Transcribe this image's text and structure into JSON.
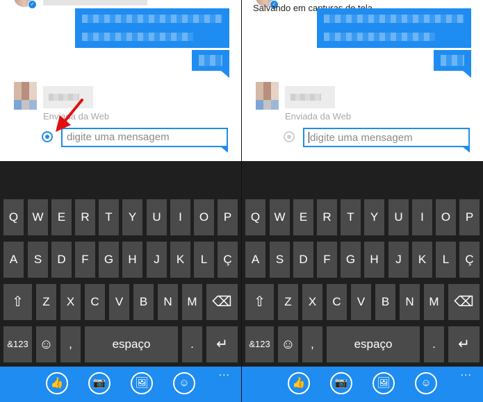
{
  "panels": [
    {
      "status_toast": "",
      "sent_label": "Enviada da Web",
      "input_placeholder": "digite uma mensagem",
      "show_arrow": true,
      "radio_active": true,
      "show_caret": false
    },
    {
      "status_toast": "Salvando em capturas de tela...",
      "sent_label": "Enviada da Web",
      "input_placeholder": "digite uma mensagem",
      "show_arrow": false,
      "radio_active": false,
      "show_caret": true
    }
  ],
  "keyboard": {
    "row1": [
      "Q",
      "W",
      "E",
      "R",
      "T",
      "Y",
      "U",
      "I",
      "O",
      "P"
    ],
    "row2": [
      "A",
      "S",
      "D",
      "F",
      "G",
      "H",
      "J",
      "K",
      "L",
      "Ç"
    ],
    "row3": [
      "Z",
      "X",
      "C",
      "V",
      "B",
      "N",
      "M"
    ],
    "shift_icon": "shift-arrow-icon",
    "backspace_icon": "backspace-icon",
    "symbols_label": "&123",
    "emoji_icon": "emoji-icon",
    "comma": ",",
    "space_label": "espaço",
    "period": ".",
    "enter_icon": "enter-icon"
  },
  "appbar": {
    "buttons": [
      "like-icon",
      "camera-icon",
      "gallery-icon",
      "emoji-icon"
    ],
    "more": "..."
  },
  "colors": {
    "accent": "#1e8cf0",
    "key_bg": "#4a4a4a",
    "keyboard_bg": "#1f1f1f"
  }
}
